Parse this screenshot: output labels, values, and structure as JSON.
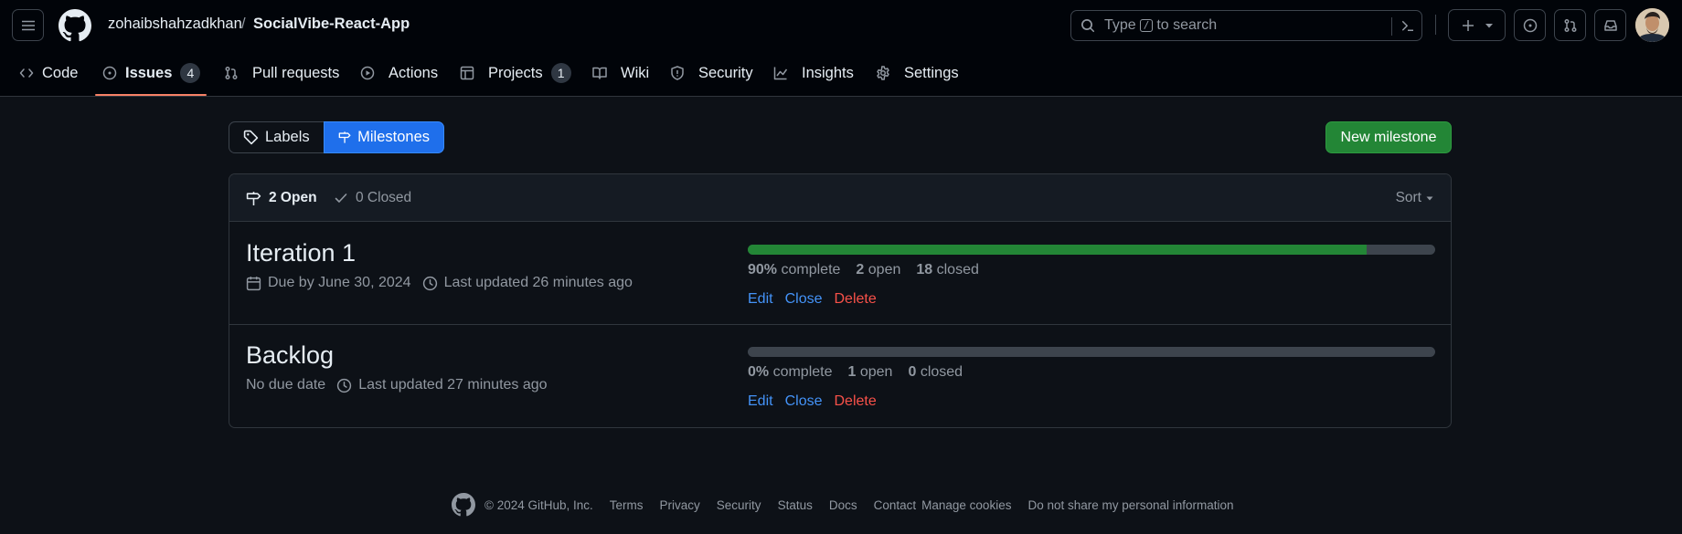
{
  "header": {
    "owner": "zohaibshahzadkhan",
    "separator": "/",
    "repo": "SocialVibe-React-App",
    "search": {
      "prefix": "Type",
      "key": "/",
      "suffix": "to search"
    }
  },
  "nav": {
    "code": "Code",
    "issues": "Issues",
    "issues_count": "4",
    "pull_requests": "Pull requests",
    "actions": "Actions",
    "projects": "Projects",
    "projects_count": "1",
    "wiki": "Wiki",
    "security": "Security",
    "insights": "Insights",
    "settings": "Settings"
  },
  "toolbar": {
    "labels": "Labels",
    "milestones": "Milestones",
    "new_milestone": "New milestone"
  },
  "list_header": {
    "open": "2 Open",
    "closed": "0 Closed",
    "sort": "Sort"
  },
  "milestones": [
    {
      "title": "Iteration 1",
      "due": "Due by June 30, 2024",
      "updated": "Last updated 26 minutes ago",
      "progress": 0.9,
      "percent": "90%",
      "complete_label": "complete",
      "open_count": "2",
      "open_label": "open",
      "closed_count": "18",
      "closed_label": "closed",
      "edit": "Edit",
      "close": "Close",
      "delete": "Delete"
    },
    {
      "title": "Backlog",
      "due": "No due date",
      "updated": "Last updated 27 minutes ago",
      "progress": 0,
      "percent": "0%",
      "complete_label": "complete",
      "open_count": "1",
      "open_label": "open",
      "closed_count": "0",
      "closed_label": "closed",
      "edit": "Edit",
      "close": "Close",
      "delete": "Delete"
    }
  ],
  "footer": {
    "copyright": "© 2024 GitHub, Inc.",
    "links": [
      "Terms",
      "Privacy",
      "Security",
      "Status",
      "Docs",
      "Contact",
      "Manage cookies",
      "Do not share my personal information"
    ]
  },
  "colors": {
    "background": "#0d1117",
    "header_bg": "#010409",
    "accent_blue": "#1f6feb",
    "success_green": "#238636",
    "danger_red": "#f85149",
    "link_blue": "#4493f8",
    "tab_underline": "#f78166"
  }
}
